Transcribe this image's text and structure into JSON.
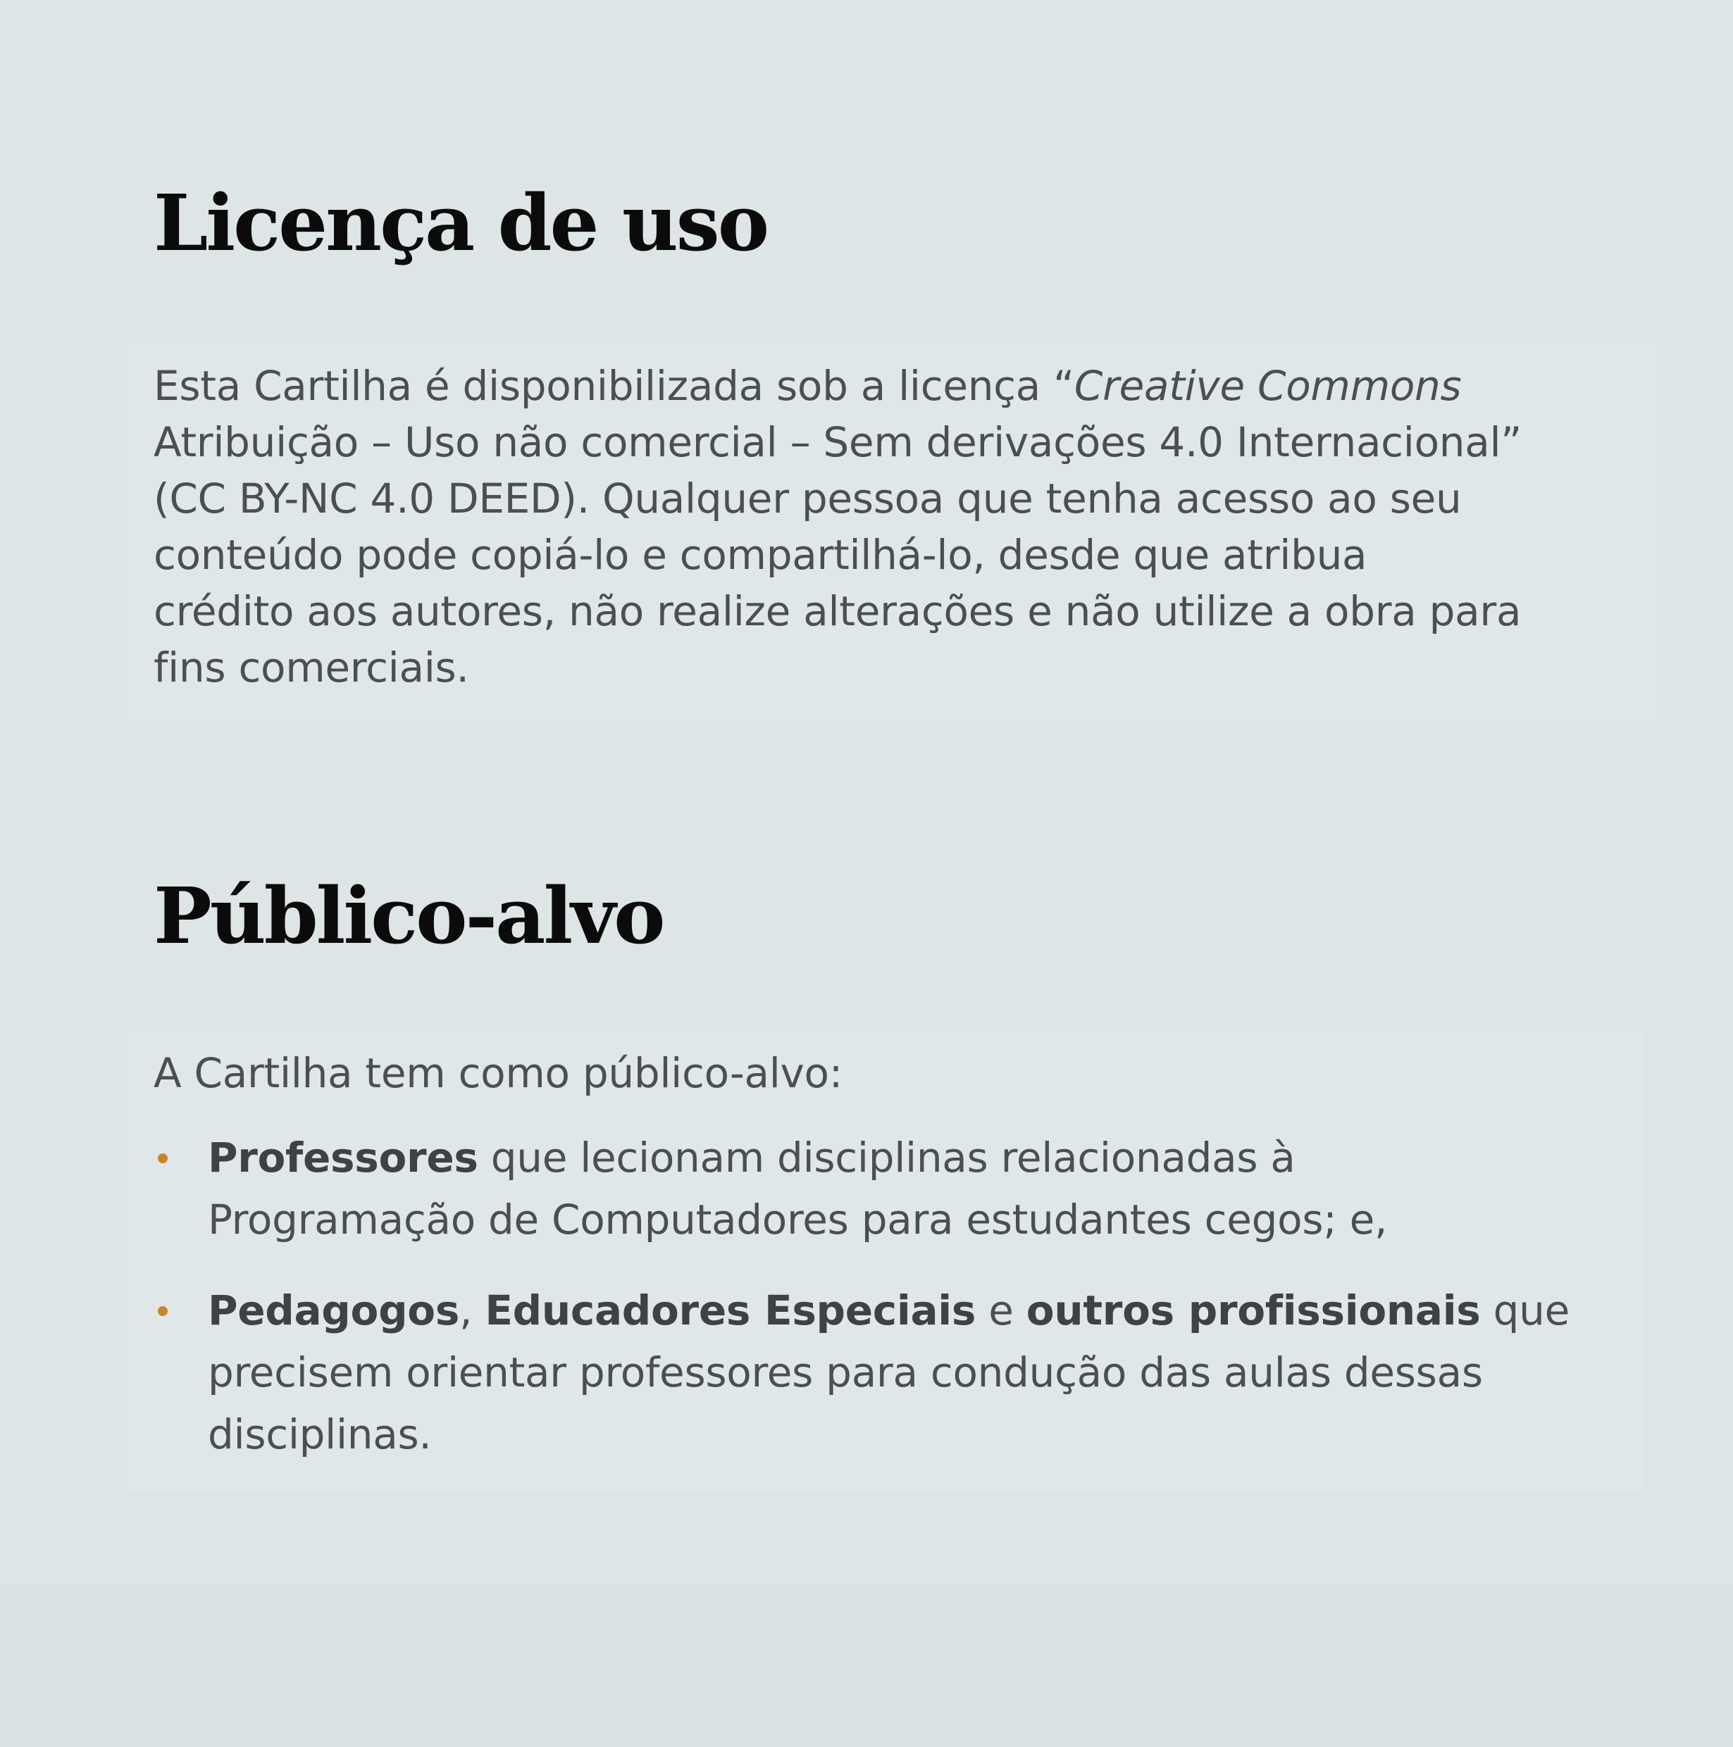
{
  "licenca": {
    "title": "Licença de uso",
    "lines": [
      {
        "pre": "Esta Cartilha é disponibilizada sob a licença “",
        "italic": "Creative Commons",
        "post": ""
      },
      {
        "pre": "Atribuição – Uso não comercial – Sem derivações 4.0 Internacional”",
        "italic": "",
        "post": ""
      },
      {
        "pre": "(CC BY-NC 4.0 DEED). Qualquer pessoa que tenha acesso ao seu",
        "italic": "",
        "post": ""
      },
      {
        "pre": "conteúdo pode copiá-lo e compartilhá-lo, desde que atribua",
        "italic": "",
        "post": ""
      },
      {
        "pre": "crédito aos autores, não realize alterações e não utilize a obra para",
        "italic": "",
        "post": ""
      },
      {
        "pre": "fins comerciais.",
        "italic": "",
        "post": ""
      }
    ]
  },
  "publico": {
    "title": "Público-alvo",
    "intro": "A Cartilha tem como público-alvo:",
    "items": [
      {
        "bold1": "Professores",
        "text1": " que lecionam disciplinas relacionadas à",
        "line2": "Programação de Computadores para estudantes cegos; e,"
      },
      {
        "bold1": "Pedagogos",
        "text1": ", ",
        "bold2": "Educadores Especiais",
        "text2": " e ",
        "bold3": "outros profissionais",
        "text3": " que",
        "line2": "precisem orientar professores para condução das aulas dessas",
        "line3": "disciplinas."
      }
    ]
  },
  "colors": {
    "background": "#dde5e6",
    "heading": "#0b0b0b",
    "body_text": "#4b4f52",
    "bullet": "#c8862a"
  }
}
